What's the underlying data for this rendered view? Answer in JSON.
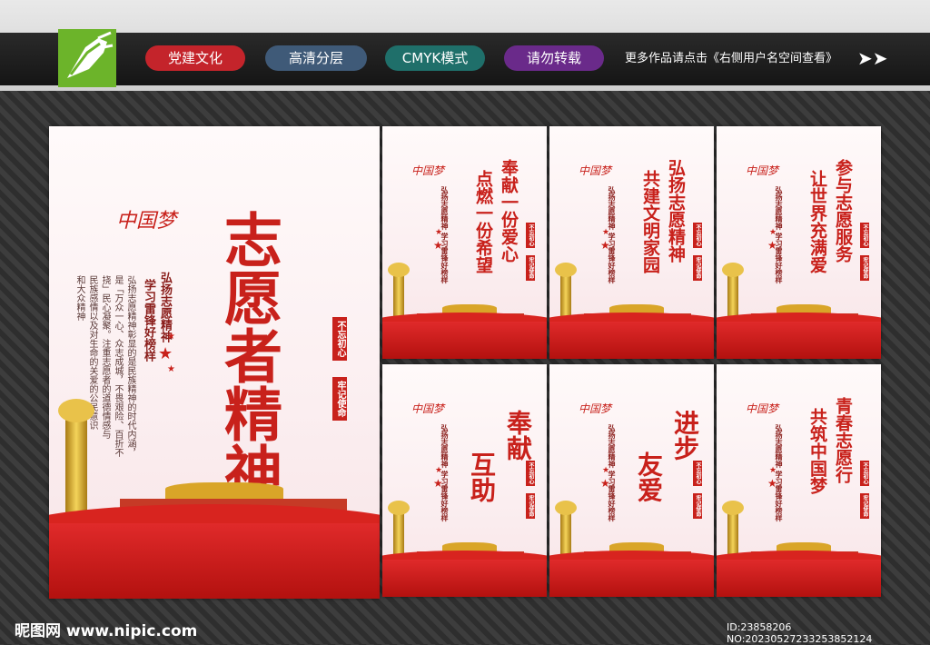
{
  "header": {
    "tags": [
      {
        "label": "党建文化",
        "color": "#c4242b"
      },
      {
        "label": "高清分层",
        "color": "#3f5a78"
      },
      {
        "label": "CMYK模式",
        "color": "#1f6f6a"
      },
      {
        "label": "请勿转载",
        "color": "#6a2a8a"
      }
    ],
    "note": "更多作品请点击《右侧用户名空间查看》"
  },
  "main_poster": {
    "mark": "中国梦",
    "title": "志愿者精神",
    "subtitle_1": "弘扬志愿精神",
    "subtitle_2": "学习雷锋好榜样",
    "body_1": "弘扬志愿精神彰显的是民族精神的时代内涵，",
    "body_2": "是「万众一心、众志成城，不畏艰险、百折不",
    "body_3": "挠」民心凝聚。注重志愿者的道德情感与",
    "body_4": "民族感情以及对生命的关爱的公民意识",
    "body_5": "和大众精神",
    "badge_1": "不忘初心",
    "badge_2": "牢记使命"
  },
  "small_posters": [
    {
      "line1": "奉献一份爱心",
      "line2": "点燃一份希望"
    },
    {
      "line1": "弘扬志愿精神",
      "line2": "共建文明家园"
    },
    {
      "line1": "参与志愿服务",
      "line2": "让世界充满爱"
    },
    {
      "line1": "奉献",
      "line2": "互助"
    },
    {
      "line1": "进步",
      "line2": "友爱"
    },
    {
      "line1": "青春志愿行",
      "line2": "共筑中国梦"
    }
  ],
  "small_common": {
    "mark": "中国梦",
    "sub": "弘扬志愿精神 学习雷锋好榜样",
    "badge_1": "不忘初心",
    "badge_2": "牢记使命"
  },
  "footer": {
    "site": "昵图网 www.nipic.com",
    "id": "ID:23858206 NO:20230527233253852124"
  }
}
